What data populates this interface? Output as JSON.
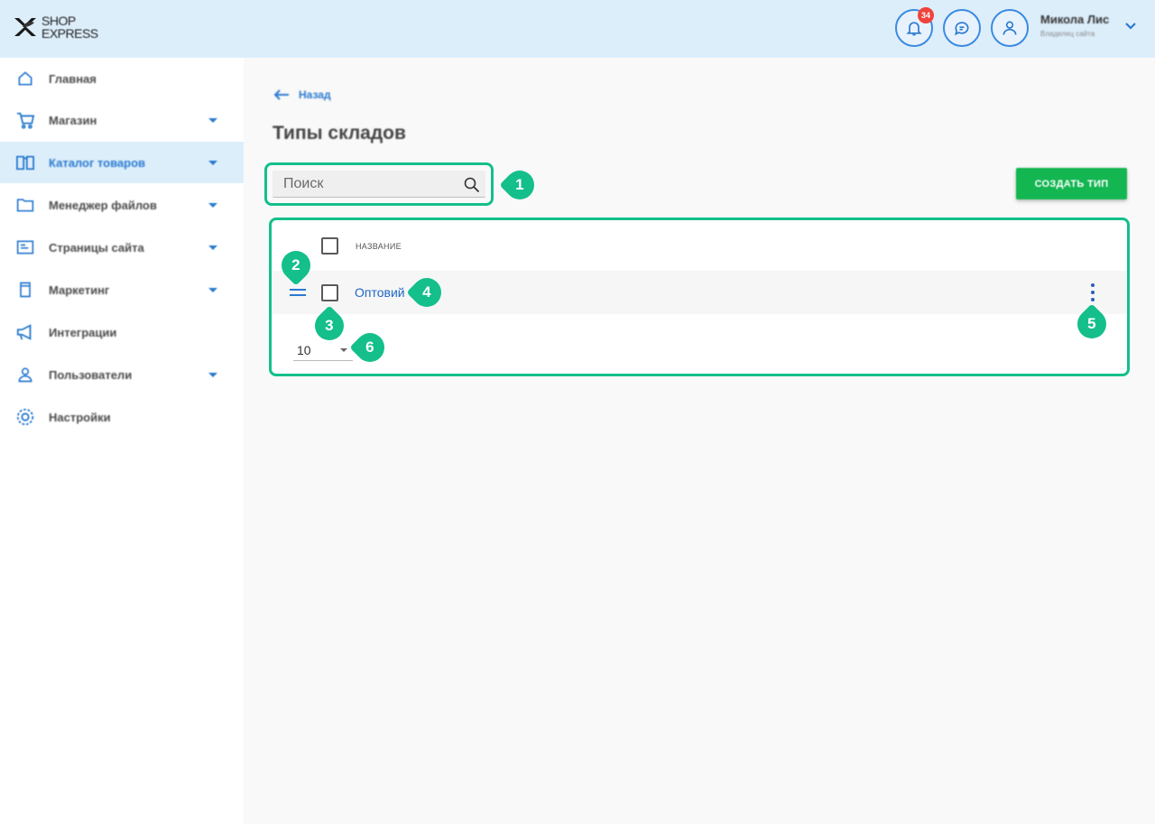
{
  "app": {
    "logo_line1": "SHOP",
    "logo_line2": "EXPRESS"
  },
  "header": {
    "notifications_count": "34",
    "user_name": "Микола Лис",
    "user_role": "Владелец сайта"
  },
  "sidebar": {
    "items": [
      {
        "label": "Главная",
        "icon": "home-icon"
      },
      {
        "label": "Магазин",
        "icon": "cart-icon"
      },
      {
        "label": "Каталог товаров",
        "icon": "book-icon"
      },
      {
        "label": "Менеджер файлов",
        "icon": "folder-icon"
      },
      {
        "label": "Страницы сайта",
        "icon": "page-icon"
      },
      {
        "label": "Маркетинг",
        "icon": "tag-icon"
      },
      {
        "label": "Интеграции",
        "icon": "megaphone-icon"
      },
      {
        "label": "Пользователи",
        "icon": "users-icon"
      },
      {
        "label": "Настройки",
        "icon": "gear-icon"
      }
    ]
  },
  "main": {
    "back_label": "Назад",
    "title": "Типы складов",
    "search_placeholder": "Поиск",
    "create_button": "СОЗДАТЬ ТИП",
    "table": {
      "column_name": "НАЗВАНИЕ",
      "rows": [
        {
          "name": "Оптовий"
        }
      ]
    },
    "per_page": "10"
  },
  "markers": [
    "1",
    "2",
    "3",
    "4",
    "5",
    "6"
  ],
  "colors": {
    "accent": "#2a7ad0",
    "marker": "#14bf8b",
    "create_button": "#13b651",
    "header_bg": "#ddeefb"
  }
}
